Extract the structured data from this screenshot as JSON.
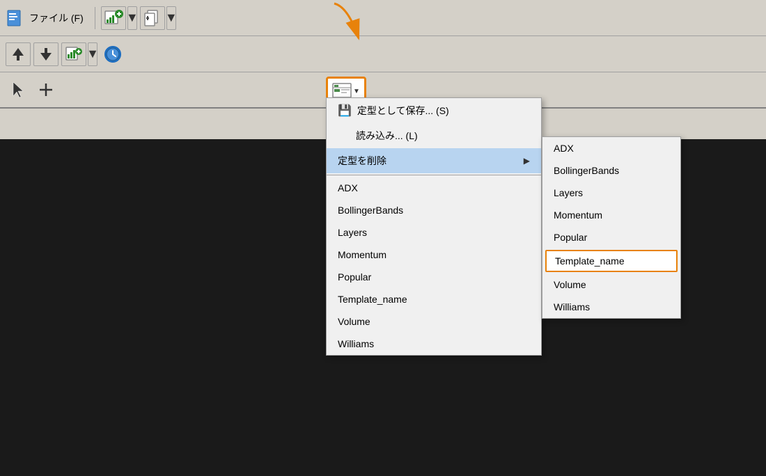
{
  "toolbar": {
    "menu_file": "ファイル (F)",
    "btn_labels": {
      "save_template": "定型として保存... (S)",
      "load_template": "読み込み... (L)",
      "delete_template": "定型を削除"
    }
  },
  "main_menu": {
    "save_label": "定型として保存... (S)",
    "load_label": "読み込み... (L)",
    "delete_label": "定型を削除",
    "items": [
      {
        "id": "adx",
        "label": "ADX"
      },
      {
        "id": "bollinger",
        "label": "BollingerBands"
      },
      {
        "id": "layers",
        "label": "Layers"
      },
      {
        "id": "momentum",
        "label": "Momentum"
      },
      {
        "id": "popular",
        "label": "Popular"
      },
      {
        "id": "template_name",
        "label": "Template_name"
      },
      {
        "id": "volume",
        "label": "Volume"
      },
      {
        "id": "williams",
        "label": "Williams"
      }
    ]
  },
  "submenu": {
    "items": [
      {
        "id": "adx",
        "label": "ADX"
      },
      {
        "id": "bollinger",
        "label": "BollingerBands"
      },
      {
        "id": "layers",
        "label": "Layers"
      },
      {
        "id": "momentum",
        "label": "Momentum"
      },
      {
        "id": "popular",
        "label": "Popular"
      },
      {
        "id": "template_name",
        "label": "Template_name",
        "highlighted": true
      },
      {
        "id": "volume",
        "label": "Volume"
      },
      {
        "id": "williams",
        "label": "Williams"
      }
    ]
  },
  "annotation": {
    "arrow_color": "#e8820a",
    "highlight_color": "#e8820a"
  }
}
